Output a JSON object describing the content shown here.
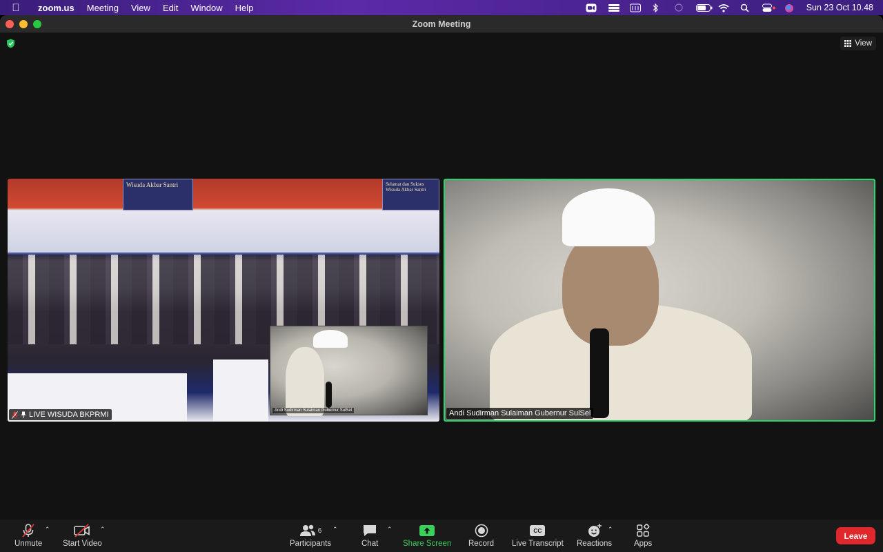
{
  "menubar": {
    "app": "zoom.us",
    "items": [
      "Meeting",
      "View",
      "Edit",
      "Window",
      "Help"
    ],
    "clock": "Sun 23 Oct  10.48"
  },
  "window": {
    "title": "Zoom Meeting",
    "view_label": "View"
  },
  "tiles": {
    "left_name": "LIVE WISUDA BKPRMI",
    "left_banner_1": "Wisuda Akbar Santri",
    "left_banner_2": "Selamat dan Sukses Wisuda Akbar Santri",
    "pip_name": "Andi Sudirman Sulaiman Gubernur SulSel",
    "right_name": "Andi Sudirman Sulaiman Gubernur SulSel"
  },
  "toolbar": {
    "unmute": "Unmute",
    "start_video": "Start Video",
    "participants": "Participants",
    "participants_count": "6",
    "chat": "Chat",
    "share_screen": "Share Screen",
    "record": "Record",
    "live_transcript": "Live Transcript",
    "cc": "CC",
    "reactions": "Reactions",
    "apps": "Apps",
    "leave": "Leave"
  },
  "colors": {
    "active_speaker_border": "#23d96b",
    "share_green": "#3ad15a",
    "leave_red": "#e0282c"
  }
}
